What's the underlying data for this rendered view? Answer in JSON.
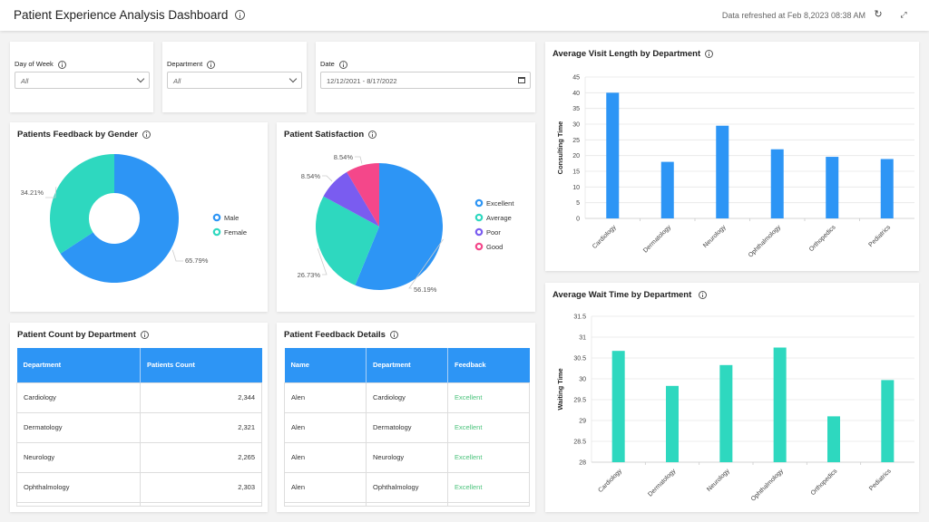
{
  "header": {
    "title": "Patient Experience Analysis Dashboard",
    "refreshed": "Data refreshed at Feb 8,2023 08:38 AM",
    "refresh_icon": "refresh-icon",
    "collapse_icon": "collapse-icon"
  },
  "filters": {
    "day_of_week": {
      "label": "Day of Week",
      "value": "All"
    },
    "department": {
      "label": "Department",
      "value": "All"
    },
    "date": {
      "label": "Date",
      "value": "12/12/2021 - 8/17/2022"
    }
  },
  "colors": {
    "blue": "#2d95f5",
    "teal": "#2ed8bf",
    "purple": "#7a5cf0",
    "pink": "#f4478a",
    "feedback_green": "#4cc37c"
  },
  "gender_card": {
    "title": "Patients Feedback by Gender"
  },
  "satisfaction_card": {
    "title": "Patient Satisfaction"
  },
  "visit_card": {
    "title": "Average Visit Length by Department"
  },
  "wait_card": {
    "title": "Average Wait Time by Department"
  },
  "count_table": {
    "title": "Patient Count by Department",
    "columns": [
      "Department",
      "Patients Count"
    ],
    "rows": [
      [
        "Cardiology",
        "2,344"
      ],
      [
        "Dermatology",
        "2,321"
      ],
      [
        "Neurology",
        "2,265"
      ],
      [
        "Ophthalmology",
        "2,303"
      ]
    ]
  },
  "feedback_table": {
    "title": "Patient Feedback Details",
    "columns": [
      "Name",
      "Department",
      "Feedback"
    ],
    "rows": [
      [
        "Alen",
        "Cardiology",
        "Excellent"
      ],
      [
        "Alen",
        "Dermatology",
        "Excellent"
      ],
      [
        "Alen",
        "Neurology",
        "Excellent"
      ],
      [
        "Alen",
        "Ophthalmology",
        "Excellent"
      ]
    ]
  },
  "chart_data": [
    {
      "type": "pie",
      "variant": "donut",
      "title": "Patients Feedback by Gender",
      "categories": [
        "Male",
        "Female"
      ],
      "values": [
        65.79,
        34.21
      ],
      "labels": [
        "65.79%",
        "34.21%"
      ],
      "legend": "right"
    },
    {
      "type": "pie",
      "title": "Patient Satisfaction",
      "categories": [
        "Excellent",
        "Average",
        "Poor",
        "Good"
      ],
      "values": [
        56.19,
        26.73,
        8.54,
        8.54
      ],
      "labels": [
        "56.19%",
        "26.73%",
        "8.54%",
        "8.54%"
      ],
      "legend": "right"
    },
    {
      "type": "bar",
      "title": "Average Visit Length by Department",
      "categories": [
        "Cardiology",
        "Dermatology",
        "Neurology",
        "Ophthalmology",
        "Orthopedics",
        "Pediatrics"
      ],
      "values": [
        40,
        18,
        29.5,
        22,
        19.6,
        18.9
      ],
      "xlabel": "",
      "ylabel": "Consulting Time",
      "ylim": [
        0,
        45
      ],
      "yticks": [
        0,
        5,
        10,
        15,
        20,
        25,
        30,
        35,
        40,
        45
      ],
      "grid": true
    },
    {
      "type": "bar",
      "title": "Average Wait Time by Department",
      "categories": [
        "Cardiology",
        "Dermatology",
        "Neurology",
        "Ophthalmology",
        "Orthopedics",
        "Pediatrics"
      ],
      "values": [
        30.67,
        29.83,
        30.33,
        30.75,
        29.1,
        29.97
      ],
      "xlabel": "",
      "ylabel": "Waiting Time",
      "ylim": [
        28,
        31.5
      ],
      "yticks": [
        28,
        28.5,
        29,
        29.5,
        30,
        30.5,
        31,
        31.5
      ],
      "grid": true
    }
  ]
}
